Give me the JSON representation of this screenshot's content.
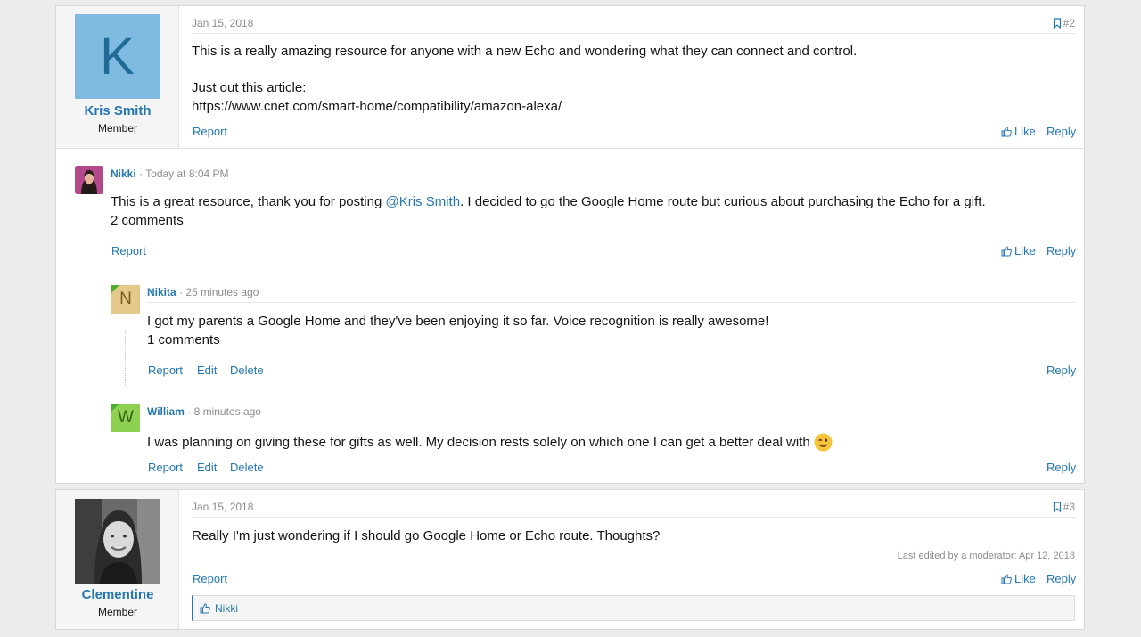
{
  "post2": {
    "author": "Kris Smith",
    "author_initial": "K",
    "author_title": "Member",
    "date": "Jan 15, 2018",
    "number": "#2",
    "line1": "This is a really amazing resource for anyone with a new Echo and wondering what they can connect and control.",
    "line2": "Just out this article:",
    "link": "https://www.cnet.com/smart-home/compatibility/amazon-alexa/",
    "report": "Report",
    "like": "Like",
    "reply": "Reply"
  },
  "comment_nikki": {
    "author": "Nikki",
    "time": "· Today at 8:04 PM",
    "text_before": "This is a great resource, thank you for posting ",
    "mention": "@Kris Smith",
    "text_after": ". I decided to go the Google Home route but curious about purchasing the Echo for a gift.",
    "comments_link": "2 comments",
    "report": "Report",
    "like": "Like",
    "reply": "Reply"
  },
  "reply_nikita": {
    "author": "Nikita",
    "initial": "N",
    "time": "· 25 minutes ago",
    "text": "I got my parents a Google Home and they've been enjoying it so far. Voice recognition is really awesome!",
    "comments_link": "1 comments",
    "report": "Report",
    "edit": "Edit",
    "delete": "Delete",
    "reply": "Reply"
  },
  "reply_william": {
    "author": "William",
    "initial": "W",
    "time": "· 8 minutes ago",
    "text": "I was planning on giving these for gifts as well. My decision rests solely on which one I can get a better deal with",
    "report": "Report",
    "edit": "Edit",
    "delete": "Delete",
    "reply": "Reply"
  },
  "post3": {
    "author": "Clementine",
    "author_title": "Member",
    "date": "Jan 15, 2018",
    "number": "#3",
    "text": "Really I'm just wondering if I should go Google Home or Echo route. Thoughts?",
    "edited": "Last edited by a moderator: Apr 12, 2018",
    "report": "Report",
    "like": "Like",
    "reply": "Reply",
    "liked_by": "Nikki"
  },
  "colors": {
    "link": "#2577b1",
    "avatar_k": "#7fbbe0",
    "avatar_n": "#e4c98a",
    "avatar_w": "#8ed152"
  }
}
